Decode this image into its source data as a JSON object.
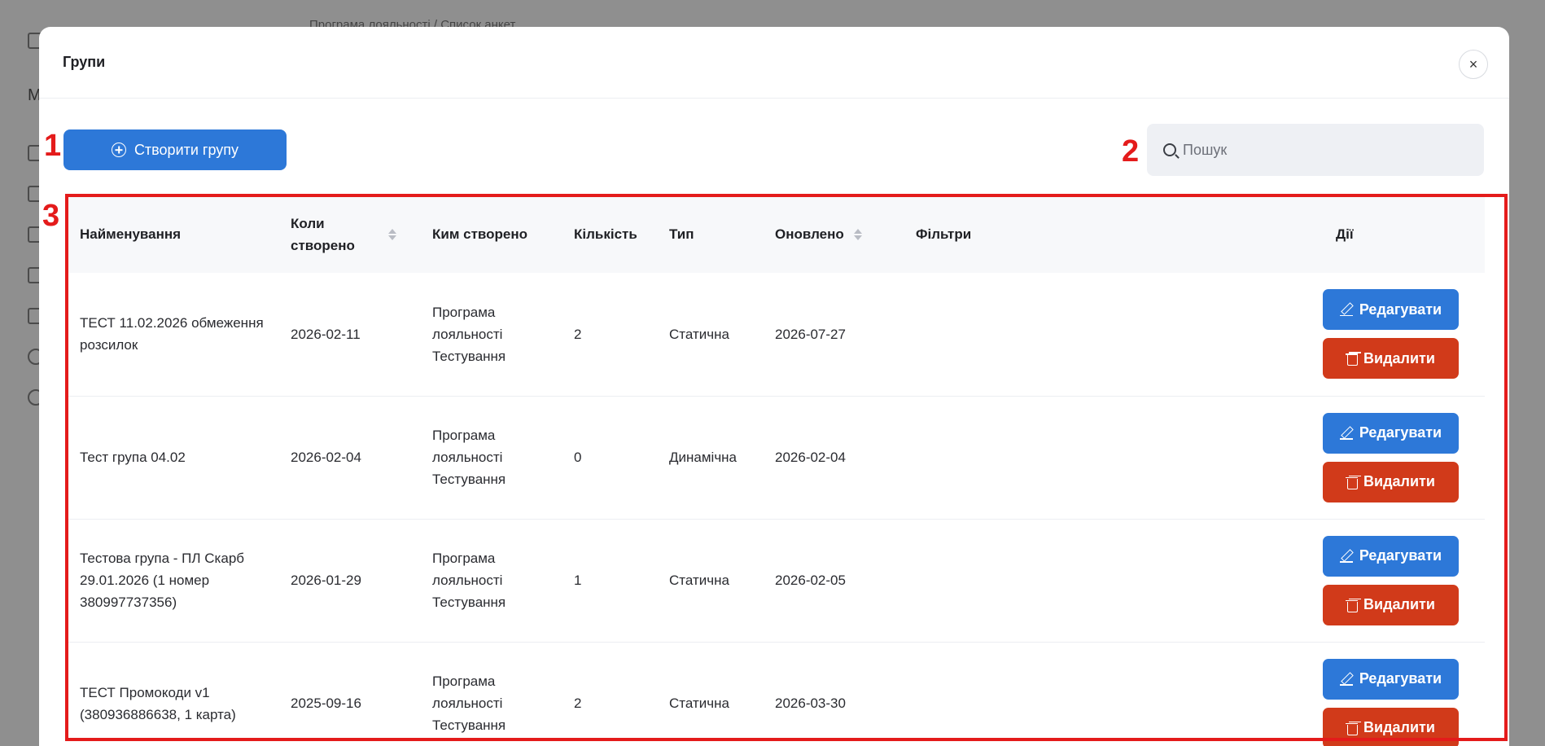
{
  "backdrop": {
    "breadcrumb": "Програма лояльності / Список анкет",
    "sidebar_letter": "М"
  },
  "modal": {
    "title": "Групи",
    "close_glyph": "×"
  },
  "toolbar": {
    "create_label": "Створити групу",
    "search_placeholder": "Пошук"
  },
  "table": {
    "headers": {
      "name": "Найменування",
      "created": "Коли створено",
      "created_by": "Ким створено",
      "count": "Кількість",
      "type": "Тип",
      "updated": "Оновлено",
      "filters": "Фільтри",
      "actions": "Дії"
    },
    "rows": [
      {
        "name": "ТЕСТ 11.02.2026 обмеження розсилок",
        "created": "2026-02-11",
        "created_by": "Програма лояльності Тестування",
        "count": "2",
        "type": "Статична",
        "updated": "2026-07-27",
        "filters": ""
      },
      {
        "name": "Тест група 04.02",
        "created": "2026-02-04",
        "created_by": "Програма лояльності Тестування",
        "count": "0",
        "type": "Динамічна",
        "updated": "2026-02-04",
        "filters": ""
      },
      {
        "name": "Тестова група - ПЛ Скарб 29.01.2026 (1 номер 380997737356)",
        "created": "2026-01-29",
        "created_by": "Програма лояльності Тестування",
        "count": "1",
        "type": "Статична",
        "updated": "2026-02-05",
        "filters": ""
      },
      {
        "name": "ТЕСТ Промокоди v1 (380936886638, 1 карта)",
        "created": "2025-09-16",
        "created_by": "Програма лояльності Тестування",
        "count": "2",
        "type": "Статична",
        "updated": "2026-03-30",
        "filters": ""
      }
    ],
    "edit_label": "Редагувати",
    "delete_label": "Видалити"
  },
  "annotations": {
    "one": "1",
    "two": "2",
    "three": "3"
  },
  "colors": {
    "primary": "#2d78d8",
    "danger": "#d13a1a",
    "annotation": "#e41b1b"
  }
}
